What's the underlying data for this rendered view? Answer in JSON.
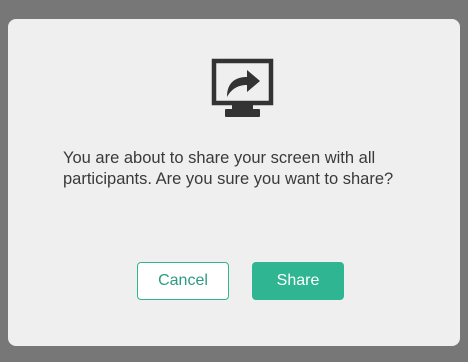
{
  "dialog": {
    "icon": "share-screen-icon",
    "message": "You are about to share your screen with all participants. Are you sure you want to share?",
    "cancel_label": "Cancel",
    "share_label": "Share"
  },
  "colors": {
    "accent": "#2fb592",
    "backdrop": "#777777",
    "dialog_bg": "#efefef",
    "icon": "#333333"
  }
}
